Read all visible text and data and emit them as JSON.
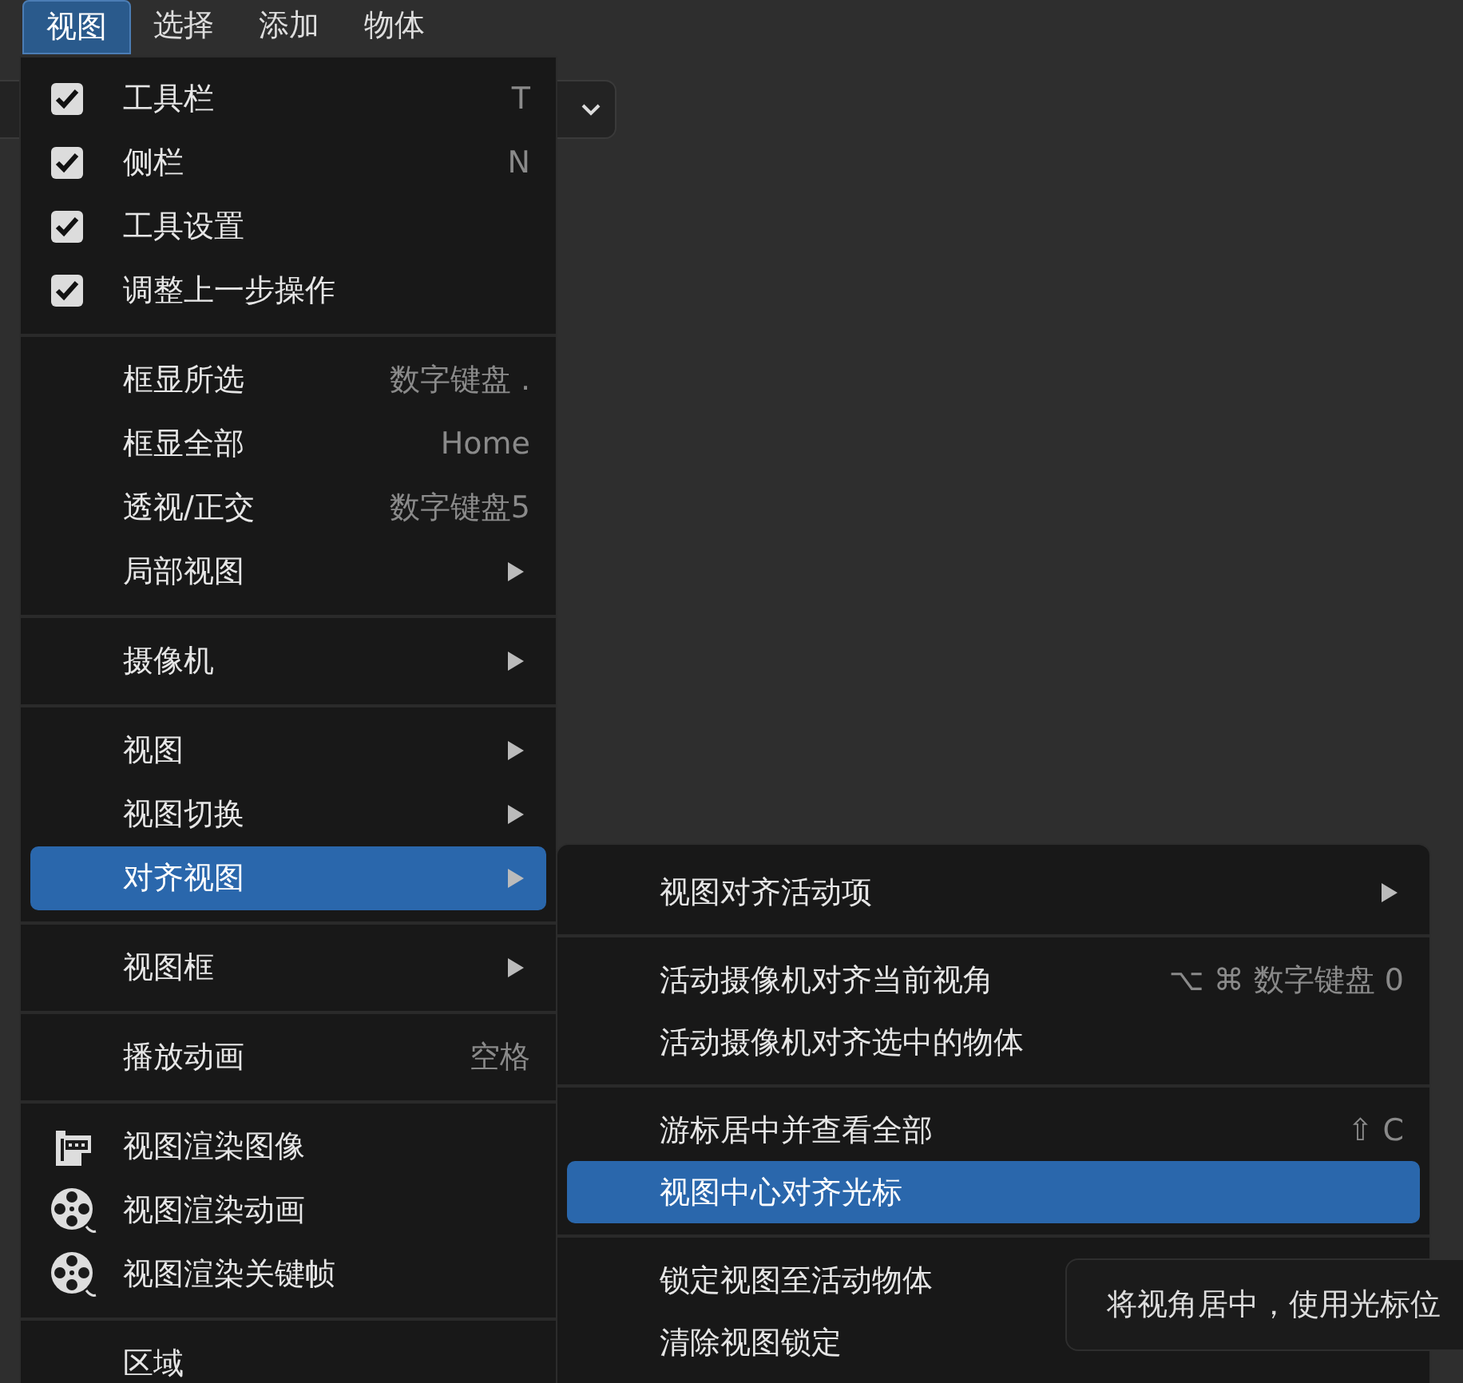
{
  "menubar": [
    {
      "label": "视图",
      "selected": true
    },
    {
      "label": "选择",
      "selected": false
    },
    {
      "label": "添加",
      "selected": false
    },
    {
      "label": "物体",
      "selected": false
    }
  ],
  "menu": {
    "sections": [
      {
        "items": [
          {
            "kind": "check",
            "label": "工具栏",
            "shortcut": "T",
            "checked": true,
            "selected": false
          },
          {
            "kind": "check",
            "label": "侧栏",
            "shortcut": "N",
            "checked": true,
            "selected": false
          },
          {
            "kind": "check",
            "label": "工具设置",
            "checked": true,
            "selected": false
          },
          {
            "kind": "check",
            "label": "调整上一步操作",
            "checked": true,
            "selected": false
          }
        ]
      },
      {
        "items": [
          {
            "kind": "plain",
            "label": "框显所选",
            "shortcut": "数字键盘 .",
            "selected": false
          },
          {
            "kind": "plain",
            "label": "框显全部",
            "shortcut": "Home",
            "selected": false
          },
          {
            "kind": "plain",
            "label": "透视/正交",
            "shortcut": "数字键盘5",
            "selected": false
          },
          {
            "kind": "submenu",
            "label": "局部视图",
            "selected": false
          }
        ]
      },
      {
        "items": [
          {
            "kind": "submenu",
            "label": "摄像机",
            "selected": false
          }
        ]
      },
      {
        "items": [
          {
            "kind": "submenu",
            "label": "视图",
            "selected": false
          },
          {
            "kind": "submenu",
            "label": "视图切换",
            "selected": false
          },
          {
            "kind": "submenu",
            "label": "对齐视图",
            "selected": true
          }
        ]
      },
      {
        "items": [
          {
            "kind": "submenu",
            "label": "视图框",
            "selected": false
          }
        ]
      },
      {
        "items": [
          {
            "kind": "plain",
            "label": "播放动画",
            "shortcut": "空格",
            "selected": false
          }
        ]
      },
      {
        "items": [
          {
            "kind": "render_image",
            "label": "视图渲染图像",
            "selected": false
          },
          {
            "kind": "render_reel",
            "label": "视图渲染动画",
            "selected": false
          },
          {
            "kind": "render_reel",
            "label": "视图渲染关键帧",
            "selected": false
          }
        ]
      },
      {
        "items": [
          {
            "kind": "plain",
            "label": "区域",
            "selected": false
          }
        ]
      }
    ]
  },
  "submenu": {
    "sections": [
      {
        "items": [
          {
            "kind": "submenu",
            "label": "视图对齐活动项",
            "selected": false
          }
        ]
      },
      {
        "items": [
          {
            "kind": "plain",
            "label": "活动摄像机对齐当前视角",
            "shortcut": "⌥ ⌘ 数字键盘 0",
            "selected": false
          },
          {
            "kind": "plain",
            "label": "活动摄像机对齐选中的物体",
            "selected": false
          }
        ]
      },
      {
        "items": [
          {
            "kind": "plain",
            "label": "游标居中并查看全部",
            "shortcut": "⇧ C",
            "selected": false
          },
          {
            "kind": "plain",
            "label": "视图中心对齐光标",
            "selected": true
          }
        ]
      },
      {
        "items": [
          {
            "kind": "plain",
            "label": "锁定视图至活动物体",
            "selected": false
          },
          {
            "kind": "plain",
            "label": "清除视图锁定",
            "selected": false
          }
        ]
      }
    ]
  },
  "tooltip": {
    "text": "将视角居中，使用光标位"
  }
}
